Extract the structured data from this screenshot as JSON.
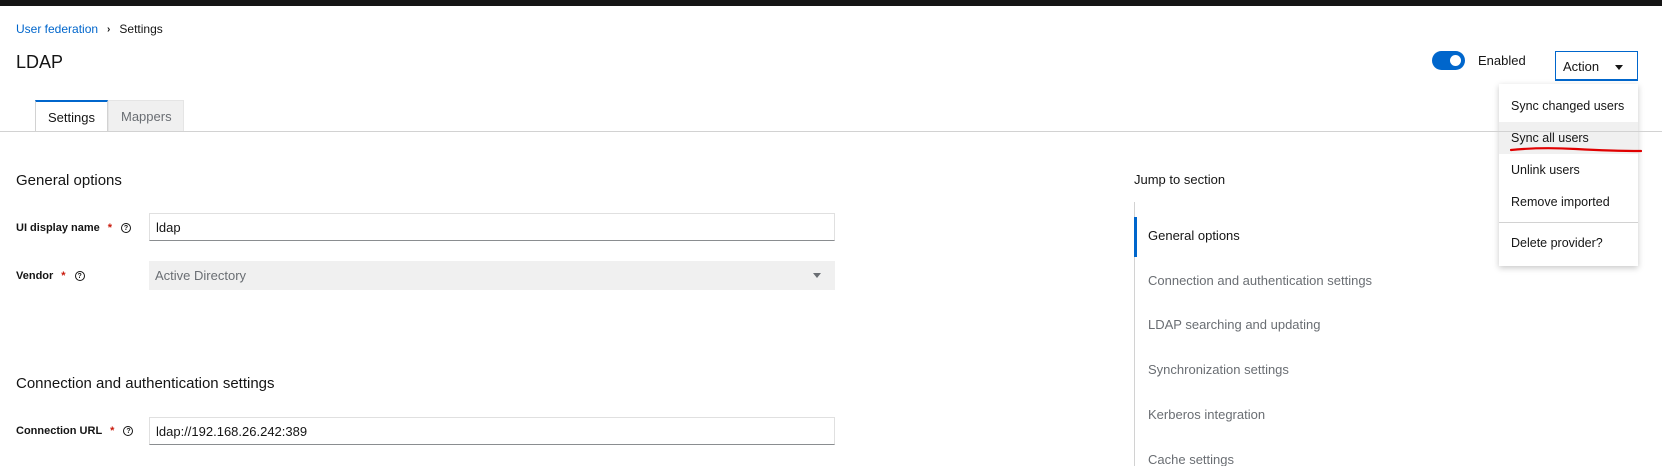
{
  "breadcrumb": {
    "parent": "User federation",
    "current": "Settings"
  },
  "page": {
    "title": "LDAP"
  },
  "header": {
    "enabled_label": "Enabled",
    "enabled_state": true,
    "action_label": "Action"
  },
  "action_menu": {
    "items": [
      "Sync changed users",
      "Sync all users",
      "Unlink users",
      "Remove imported"
    ],
    "danger_item": "Delete provider?",
    "highlighted": "Sync all users"
  },
  "tabs": [
    {
      "label": "Settings",
      "active": true
    },
    {
      "label": "Mappers",
      "active": false
    }
  ],
  "general": {
    "title": "General options",
    "ui_display_name": {
      "label": "UI display name",
      "required_mark": "*",
      "value": "ldap"
    },
    "vendor": {
      "label": "Vendor",
      "required_mark": "*",
      "value": "Active Directory"
    }
  },
  "connection": {
    "title": "Connection and authentication settings",
    "connection_url": {
      "label": "Connection URL",
      "required_mark": "*",
      "value": "ldap://192.168.26.242:389"
    }
  },
  "jump": {
    "title": "Jump to section",
    "items": [
      "General options",
      "Connection and authentication settings",
      "LDAP searching and updating",
      "Synchronization settings",
      "Kerberos integration",
      "Cache settings"
    ]
  },
  "colors": {
    "accent": "#0066cc",
    "required": "#c9190b",
    "annotation": "#e00000"
  }
}
